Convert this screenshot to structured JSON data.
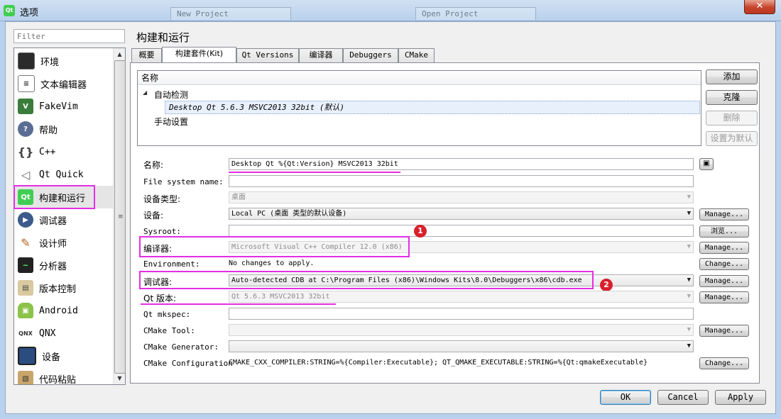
{
  "window": {
    "title": "选项",
    "ghost_tabs": [
      "New Project",
      "Open Project"
    ],
    "close_label": "✕"
  },
  "sidebar": {
    "filter_placeholder": "Filter",
    "items": [
      {
        "label": "环境",
        "icon": "monitor-icon"
      },
      {
        "label": "文本编辑器",
        "icon": "text-editor-icon"
      },
      {
        "label": "FakeVim",
        "icon": "fakevim-icon"
      },
      {
        "label": "帮助",
        "icon": "help-icon"
      },
      {
        "label": "C++",
        "icon": "cpp-braces-icon"
      },
      {
        "label": "Qt Quick",
        "icon": "qt-quick-icon"
      },
      {
        "label": "构建和运行",
        "icon": "build-run-icon"
      },
      {
        "label": "调试器",
        "icon": "debugger-icon"
      },
      {
        "label": "设计师",
        "icon": "designer-icon"
      },
      {
        "label": "分析器",
        "icon": "analyzer-icon"
      },
      {
        "label": "版本控制",
        "icon": "version-control-icon"
      },
      {
        "label": "Android",
        "icon": "android-icon"
      },
      {
        "label": "QNX",
        "icon": "qnx-icon"
      },
      {
        "label": "设备",
        "icon": "device-icon"
      },
      {
        "label": "代码粘贴",
        "icon": "code-paste-icon"
      }
    ]
  },
  "main": {
    "title": "构建和运行",
    "tabs": [
      "概要",
      "构建套件(Kit)",
      "Qt Versions",
      "编译器",
      "Debuggers",
      "CMake"
    ],
    "kits": {
      "header": "名称",
      "auto_group": "自动检测",
      "selected_kit": "Desktop Qt 5.6.3 MSVC2013 32bit (默认)",
      "manual_group": "手动设置"
    },
    "kit_buttons": {
      "add": "添加",
      "clone": "克隆",
      "remove": "删除",
      "make_default": "设置为默认"
    },
    "form": {
      "name_label": "名称:",
      "name_value": "Desktop Qt %{Qt:Version} MSVC2013 32bit",
      "fs_label": "File system name:",
      "fs_value": "",
      "device_type_label": "设备类型:",
      "device_type_value": "桌面",
      "device_label": "设备:",
      "device_value": "Local PC (桌面 类型的默认设备)",
      "sysroot_label": "Sysroot:",
      "sysroot_value": "",
      "compiler_label": "编译器:",
      "compiler_value": "Microsoft Visual C++ Compiler 12.0 (x86)",
      "environment_label": "Environment:",
      "environment_value": "No changes to apply.",
      "debugger_label": "调试器:",
      "debugger_value": "Auto-detected CDB at C:\\Program Files (x86)\\Windows Kits\\8.0\\Debuggers\\x86\\cdb.exe",
      "qt_version_label": "Qt 版本:",
      "qt_version_value": "Qt 5.6.3 MSVC2013 32bit",
      "mkspec_label": "Qt mkspec:",
      "mkspec_value": "",
      "cmake_tool_label": "CMake Tool:",
      "cmake_tool_value": "",
      "cmake_gen_label": "CMake Generator:",
      "cmake_gen_value": "",
      "cmake_config_label": "CMake Configuration",
      "cmake_config_value": "CMAKE_CXX_COMPILER:STRING=%{Compiler:Executable}; QT_QMAKE_EXECUTABLE:STRING=%{Qt:qmakeExecutable}"
    },
    "row_buttons": {
      "manage": "Manage...",
      "browse": "浏览...",
      "change": "Change..."
    },
    "annotations": {
      "badge1": "1",
      "badge2": "2"
    },
    "accent_color": "#e52de5",
    "badge_color": "#d8202d"
  },
  "footer": {
    "ok": "OK",
    "cancel": "Cancel",
    "apply": "Apply"
  }
}
